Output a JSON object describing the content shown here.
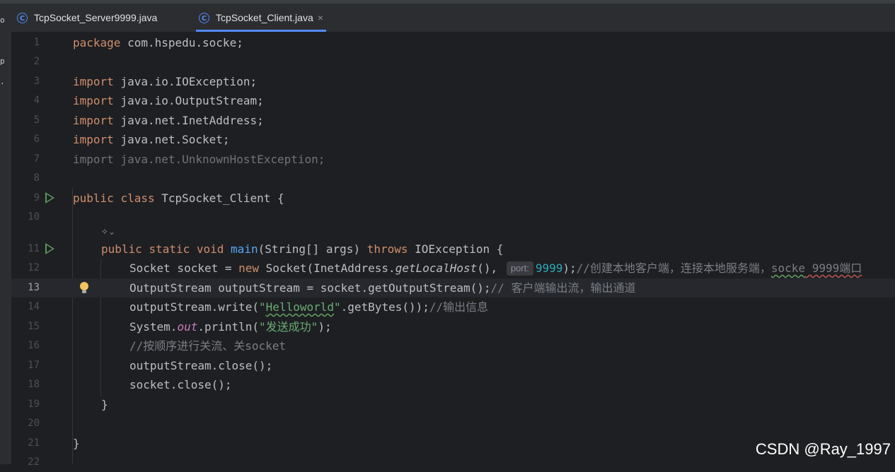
{
  "tabs": [
    {
      "label": "TcpSocket_Server9999.java",
      "icon": "java-class-icon",
      "active": false
    },
    {
      "label": "TcpSocket_Client.java",
      "icon": "java-class-icon",
      "active": true,
      "close": "×"
    }
  ],
  "left_rail": [
    "o",
    "p",
    "."
  ],
  "code_lines": {
    "l1": {
      "num": "1",
      "t1": "package",
      "t2": " com.hspedu.socke;"
    },
    "l2": {
      "num": "2"
    },
    "l3": {
      "num": "3",
      "t1": "import",
      "t2": " java.io.IOException;"
    },
    "l4": {
      "num": "4",
      "t1": "import",
      "t2": " java.io.OutputStream;"
    },
    "l5": {
      "num": "5",
      "t1": "import",
      "t2": " java.net.InetAddress;"
    },
    "l6": {
      "num": "6",
      "t1": "import",
      "t2": " java.net.Socket;"
    },
    "l7": {
      "num": "7",
      "t1": "import java.net.UnknownHostException;"
    },
    "l8": {
      "num": "8"
    },
    "l9": {
      "num": "9",
      "t1": "public",
      "t2": " ",
      "t3": "class",
      "t4": " TcpSocket_Client {"
    },
    "l10": {
      "num": "10"
    },
    "l11": {
      "num": "11",
      "t1": "public",
      "t2": " ",
      "t3": "static",
      "t4": " ",
      "t5": "void",
      "t6": " ",
      "t7": "main",
      "t8": "(String[] args) ",
      "t9": "throws",
      "t10": " IOException {"
    },
    "l12": {
      "num": "12",
      "t1": "Socket socket = ",
      "t2": "new",
      "t3": " Socket(InetAddress.",
      "t4": "getLocalHost",
      "t5": "(), ",
      "hint": "port:",
      "t6": "9999",
      "t7": ");",
      "t8": "//创建本地客户端，连接本地服务端，",
      "t9": "socke",
      "t10": " 9999端口"
    },
    "l13": {
      "num": "13",
      "t1": "OutputStream outputStream = socket.getOutputStream();",
      "t2": "// 客户端输出流，输出通道"
    },
    "l14": {
      "num": "14",
      "t1": "outputStream.write(",
      "t2": "\"",
      "t3": "Helloworld",
      "t4": "\"",
      "t5": ".getBytes());",
      "t6": "//输出信息"
    },
    "l15": {
      "num": "15",
      "t1": "System.",
      "t2": "out",
      "t3": ".println(",
      "t4": "\"发送成功\"",
      "t5": ");"
    },
    "l16": {
      "num": "16",
      "t1": "//按顺序进行关流、关socket"
    },
    "l17": {
      "num": "17",
      "t1": "outputStream.close();"
    },
    "l18": {
      "num": "18",
      "t1": "socket.close();"
    },
    "l19": {
      "num": "19",
      "t1": "}"
    },
    "l20": {
      "num": "20"
    },
    "l21": {
      "num": "21",
      "t1": "}"
    },
    "l22": {
      "num": "22"
    }
  },
  "code_lens_icon": "ai-assistant-icon",
  "watermark": "CSDN @Ray_1997",
  "colors": {
    "keyword": "#cf8e6d",
    "function": "#56a8f5",
    "string": "#6aab73",
    "number": "#2aacb8",
    "comment": "#7a7e85",
    "run": "#57965c",
    "accent": "#548af7"
  }
}
